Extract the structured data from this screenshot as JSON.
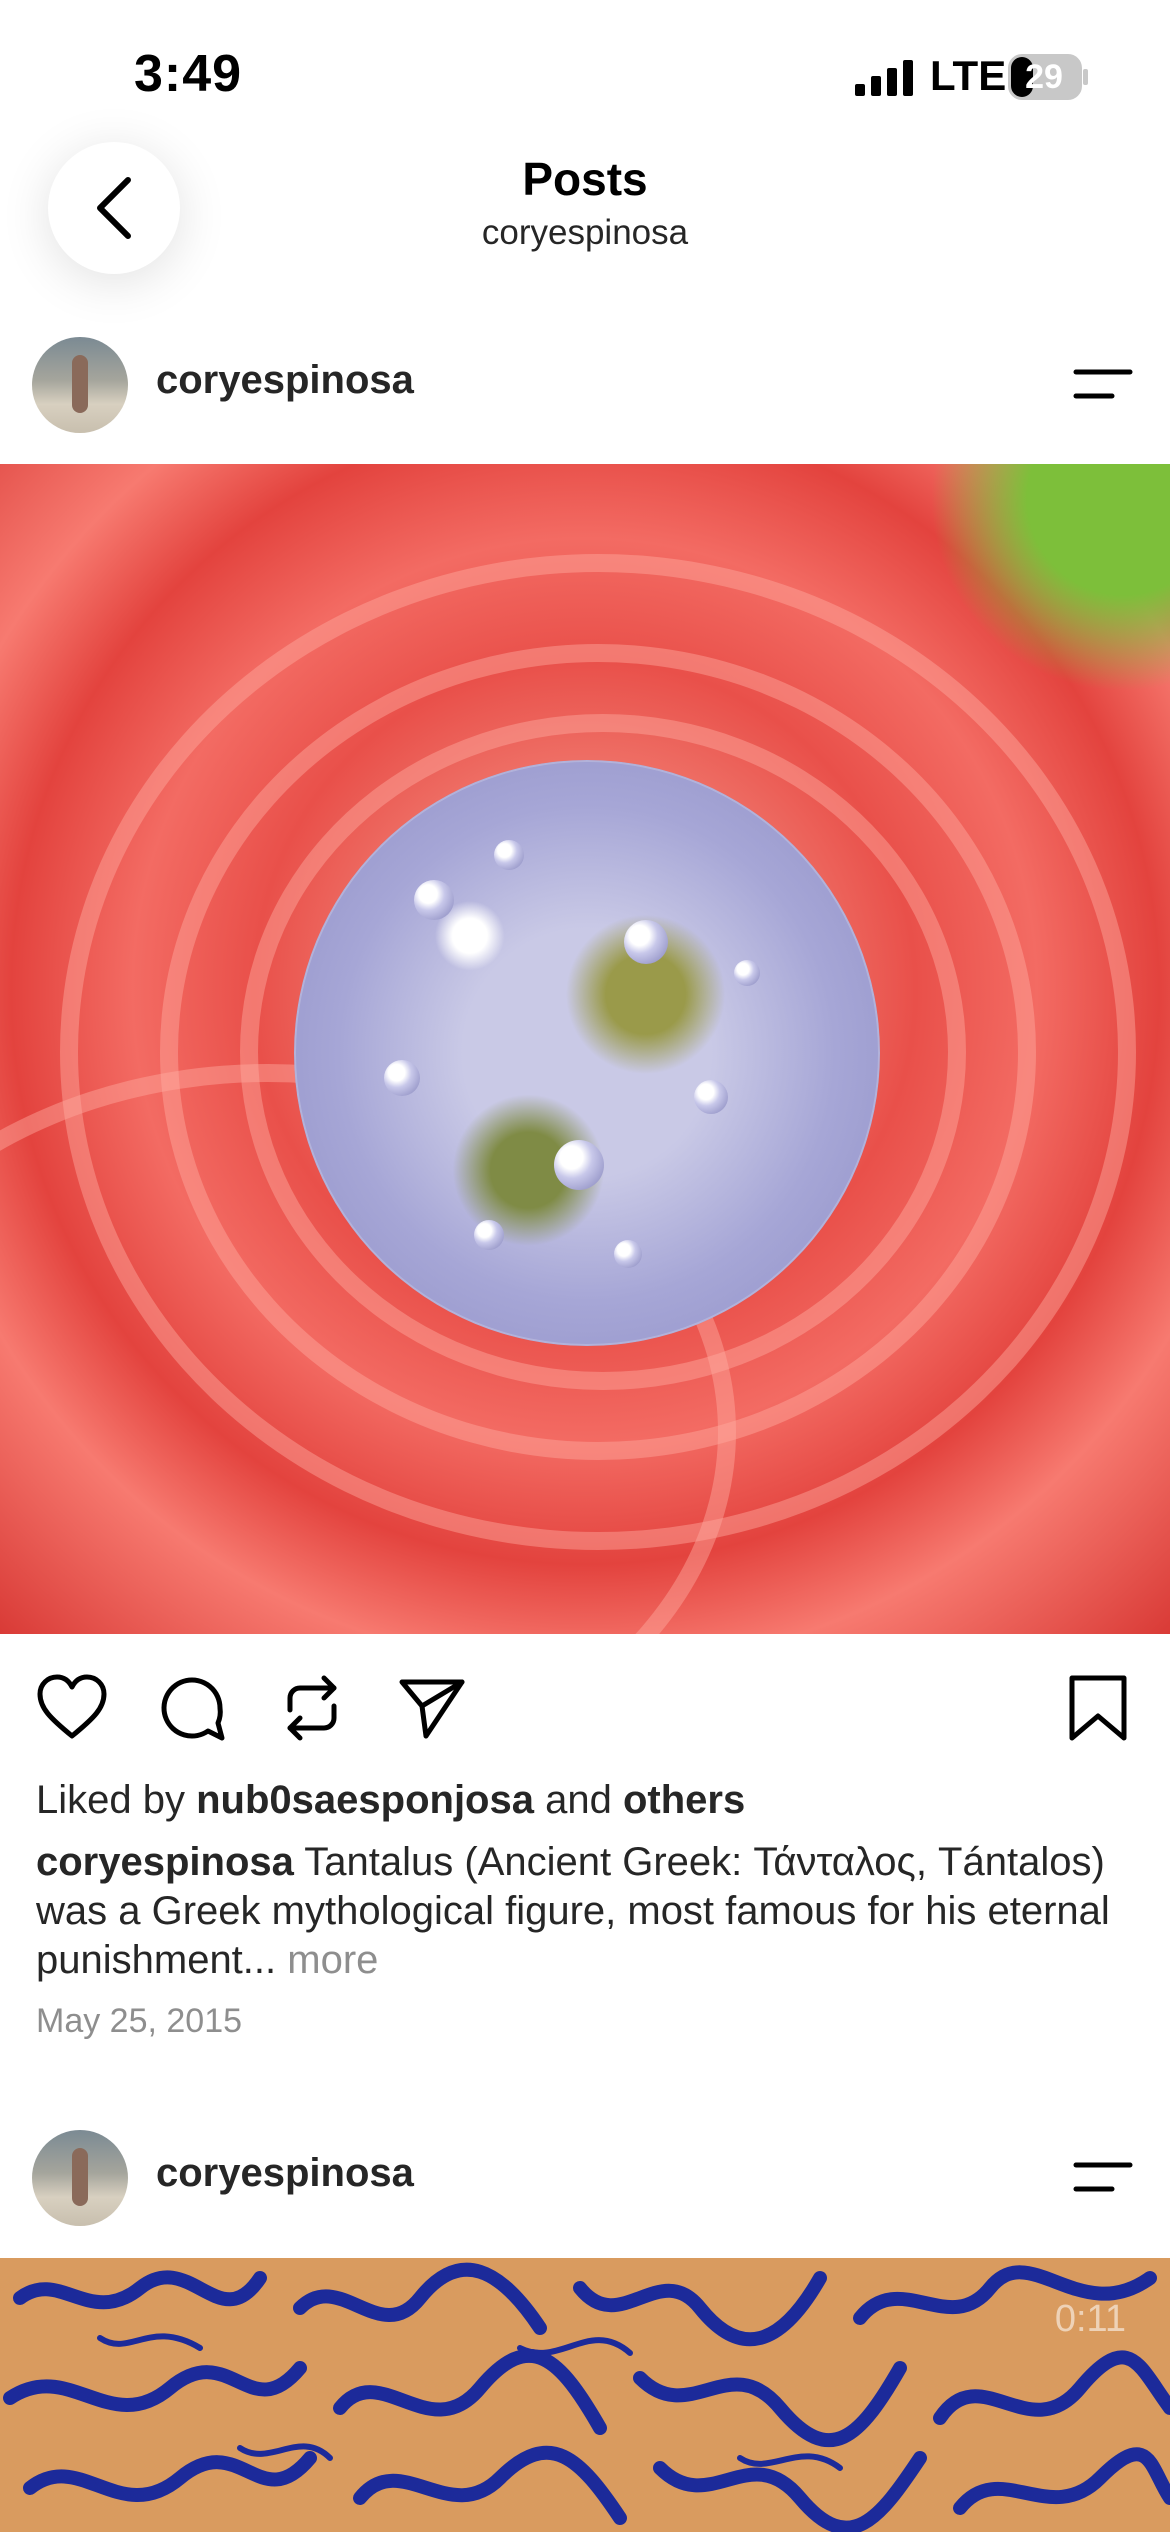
{
  "status_bar": {
    "time": "3:49",
    "network": "LTE",
    "battery": "29"
  },
  "header": {
    "title": "Posts",
    "subtitle": "coryespinosa"
  },
  "posts": [
    {
      "username": "coryespinosa",
      "liked_by_prefix": "Liked by ",
      "liked_by_user": "nub0saesponjosa",
      "liked_by_and": " and ",
      "liked_by_others": "others",
      "caption_user": "coryespinosa",
      "caption_text": " Tantalus (Ancient Greek: Τάνταλος, Tántalos) was a Greek mythological figure, most famous for his eternal punishment...",
      "more_label": " more",
      "date": "May 25, 2015"
    },
    {
      "username": "coryespinosa",
      "video_time": "0:11"
    }
  ],
  "icons": [
    "back-chevron-icon",
    "heart-icon",
    "comment-icon",
    "repost-icon",
    "share-icon",
    "bookmark-icon",
    "menu-icon"
  ],
  "colors": {
    "text": "#262626",
    "muted": "#8e8e8e",
    "rose": "#e9504a",
    "ink_blue": "#1c2a9a",
    "video_bg": "#d99b5f"
  }
}
